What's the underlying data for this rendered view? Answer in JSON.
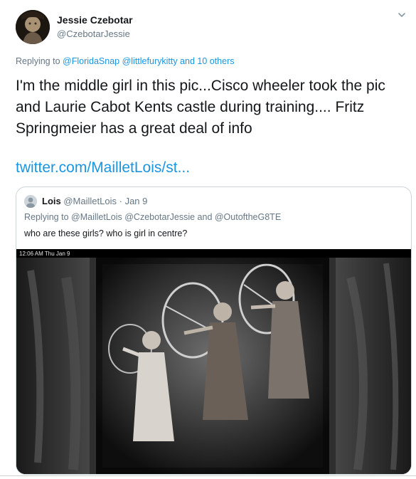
{
  "tweet": {
    "display_name": "Jessie Czebotar",
    "handle": "@CzebotarJessie",
    "replying_prefix": "Replying to",
    "replying_to": "@FloridaSnap @littlefurykitty and 10 others",
    "text": "I'm the middle girl in this pic...Cisco wheeler took the pic and Laurie Cabot Kents castle during training.... Fritz Springmeier has a great deal of info",
    "link": "twitter.com/MailletLois/st..."
  },
  "quoted": {
    "display_name": "Lois",
    "handle": "@MailletLois",
    "separator": "·",
    "date": "Jan 9",
    "replying_to": "Replying to @MailletLois @CzebotarJessie and @OutoftheG8TE",
    "text": "who are these girls?  who is girl in centre?",
    "media_status": "12:06 AM   Thu Jan 9"
  },
  "colors": {
    "link": "#1b95e0",
    "secondary_text": "#657786",
    "border": "#ccd6dd"
  },
  "icons": {
    "caret": "chevron-down-icon",
    "avatar": "user-avatar"
  }
}
